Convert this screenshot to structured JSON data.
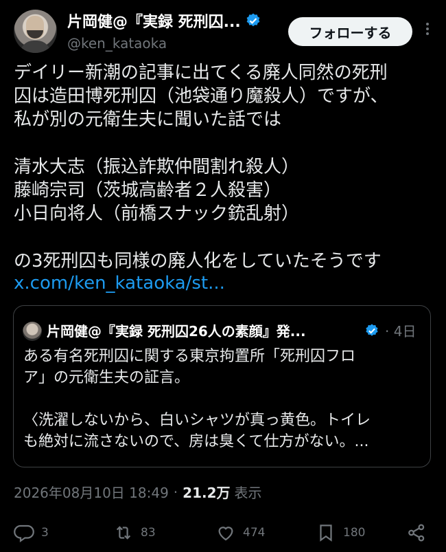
{
  "author": {
    "display_name": "片岡健@『実録 死刑囚...",
    "handle": "@ken_kataoka",
    "follow_label": "フォローする"
  },
  "tweet": {
    "text": "デイリー新潮の記事に出てくる廃人同然の死刑\n囚は造田博死刑囚（池袋通り魔殺人）ですが、\n私が別の元衛生夫に聞いた話では\n\n清水大志（振込詐欺仲間割れ殺人）\n藤崎宗司（茨城高齢者２人殺害）\n小日向将人（前橋スナック銃乱射）\n\nの3死刑囚も同様の廃人化をしていたそうです",
    "link": "x.com/ken_kataoka/st...",
    "timestamp": "2026年08月10日 18:49",
    "views_count": "21.2万",
    "views_label": "表示"
  },
  "quote": {
    "display_name": "片岡健@『実録 死刑囚26人の素顔』発...",
    "date": "· 4日",
    "text": "ある有名死刑囚に関する東京拘置所「死刑囚フロ\nア」の元衛生夫の証言。\n\n〈洗濯しないから、白いシャツが真っ黄色。トイレ\nも絶対に流さないので、房は臭くて仕方がない。..."
  },
  "actions": {
    "replies": "3",
    "reposts": "83",
    "likes": "474",
    "bookmarks": "180"
  },
  "icons": {
    "verified": "verified-badge-icon",
    "more": "more-dots-icon",
    "reply": "reply-icon",
    "repost": "repost-icon",
    "like": "heart-icon",
    "bookmark": "bookmark-icon",
    "share": "share-icon"
  },
  "colors": {
    "background": "#000000",
    "text": "#e7e9ea",
    "muted": "#71767b",
    "link": "#1d9bf0",
    "verified": "#1d9bf0",
    "follow_bg": "#eff3f4"
  }
}
